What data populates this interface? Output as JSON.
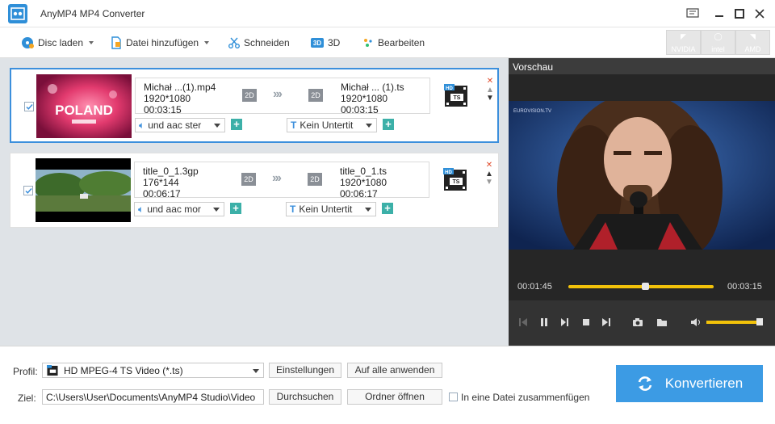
{
  "app": {
    "title": "AnyMP4 MP4 Converter"
  },
  "toolbar": {
    "disc_label": "Disc laden",
    "add_file_label": "Datei hinzufügen",
    "cut_label": "Schneiden",
    "threed_label": "3D",
    "edit_label": "Bearbeiten",
    "hw": [
      "NVIDIA",
      "intel",
      "AMD"
    ]
  },
  "files": [
    {
      "src_name": "Michał ...(1).mp4",
      "src_res": "1920*1080",
      "src_dur": "00:03:15",
      "dst_name": "Michał ... (1).ts",
      "dst_res": "1920*1080",
      "dst_dur": "00:03:15",
      "badge_in": "2D",
      "badge_out": "2D",
      "audio": "und aac ster",
      "subtitle": "Kein Untertit",
      "thumb_text": "POLAND"
    },
    {
      "src_name": "title_0_1.3gp",
      "src_res": "176*144",
      "src_dur": "00:06:17",
      "dst_name": "title_0_1.ts",
      "dst_res": "1920*1080",
      "dst_dur": "00:06:17",
      "badge_in": "2D",
      "badge_out": "2D",
      "audio": "und aac mor",
      "subtitle": "Kein Untertit"
    }
  ],
  "preview": {
    "title": "Vorschau",
    "current": "00:01:45",
    "total": "00:03:15",
    "progress": 0.53,
    "volume": 0.95,
    "watermark": "EUROVISION.TV"
  },
  "bottom": {
    "profile_label": "Profil:",
    "profile_value": "HD MPEG-4 TS Video (*.ts)",
    "settings_btn": "Einstellungen",
    "apply_all_btn": "Auf alle anwenden",
    "dest_label": "Ziel:",
    "dest_value": "C:\\Users\\User\\Documents\\AnyMP4 Studio\\Video",
    "browse_btn": "Durchsuchen",
    "open_folder_btn": "Ordner öffnen",
    "merge_label": "In eine Datei zusammenfügen",
    "convert_btn": "Konvertieren"
  },
  "colors": {
    "accent": "#3c9be4",
    "seek": "#f2c20a",
    "plus": "#3cb0a8"
  }
}
